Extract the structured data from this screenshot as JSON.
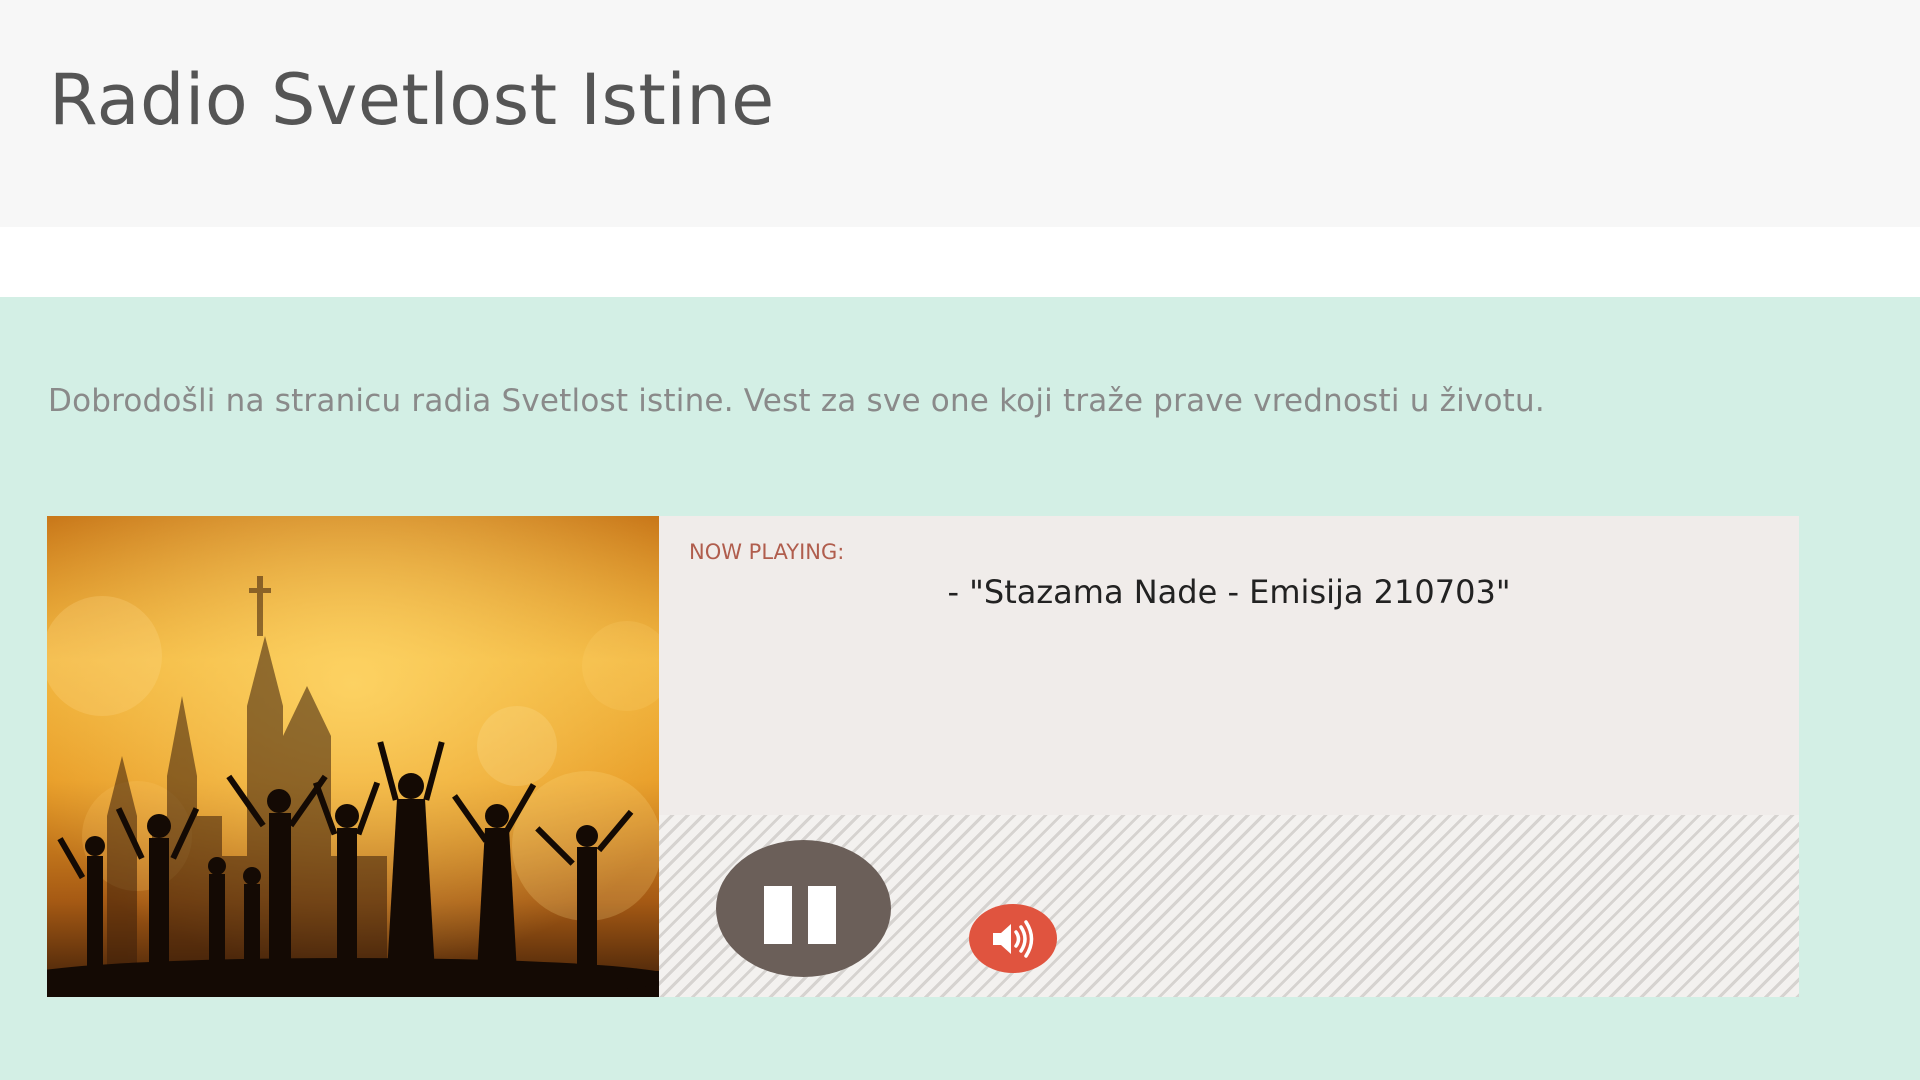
{
  "site": {
    "title": "Radio Svetlost Istine"
  },
  "content": {
    "welcome_text": "Dobrodošli na stranicu radia Svetlost istine. Vest za sve one koji traže prave vrednosti u životu."
  },
  "player": {
    "now_playing_label": "NOW PLAYING:",
    "track_title": "- \"Stazama Nade - Emisija 210703\"",
    "state": "playing",
    "controls": {
      "pause_icon": "pause-icon",
      "volume_icon": "speaker-volume-icon"
    },
    "colors": {
      "pause_button": "#6b5f59",
      "volume_button": "#e0543f",
      "now_playing_label": "#b05d4d",
      "content_background": "#d3efe5",
      "player_background": "#f0ecea"
    }
  }
}
